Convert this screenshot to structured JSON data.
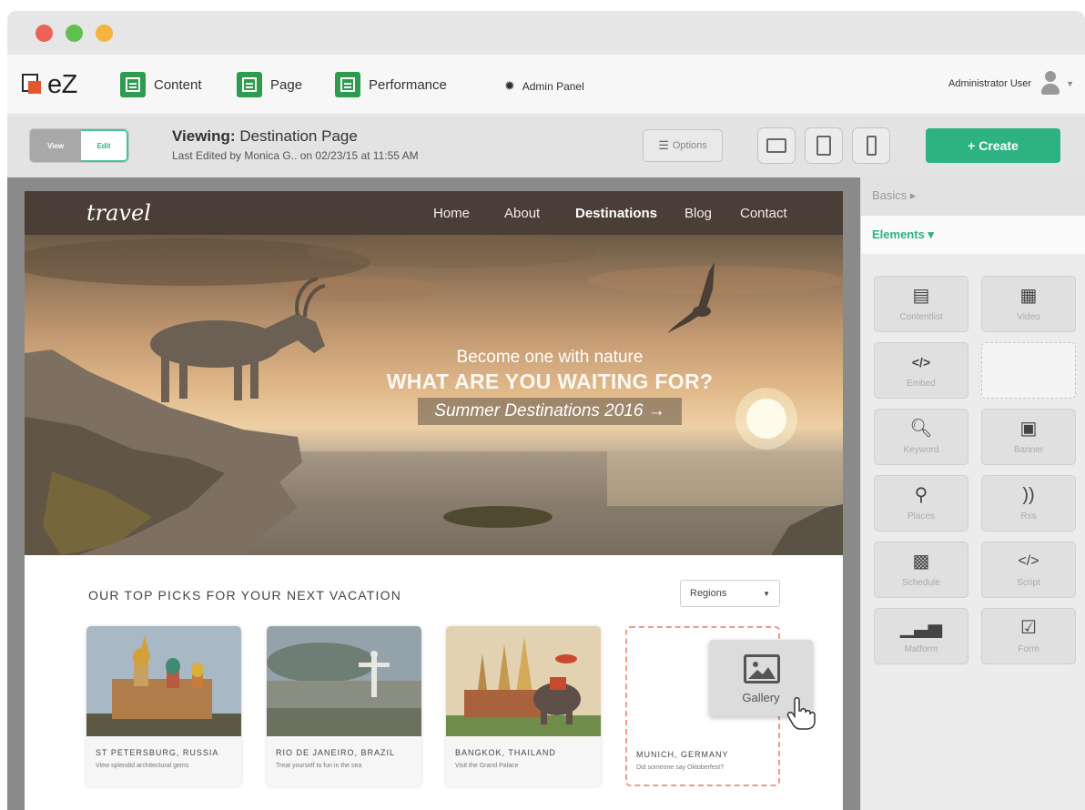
{
  "app": {
    "logo_text": "eZ"
  },
  "nav": [
    {
      "label": "Content",
      "icon": "content-icon"
    },
    {
      "label": "Page",
      "icon": "page-icon"
    },
    {
      "label": "Performance",
      "icon": "performance-icon"
    }
  ],
  "admin_panel": {
    "label": "Admin Panel",
    "icon": "gear-icon"
  },
  "user": {
    "name": "Administrator User",
    "icon": "user-avatar-icon"
  },
  "mode_toggle": {
    "view_label": "View",
    "edit_label": "Edit",
    "active": "Edit"
  },
  "viewing": {
    "prefix": "Viewing:",
    "page_name": "Destination Page",
    "last_edited": "Last Edited by Monica G.. on 02/23/15 at 11:55 AM"
  },
  "options_label": "Options",
  "devices": [
    "desktop-icon",
    "tablet-icon",
    "phone-icon"
  ],
  "create_label": "+ Create",
  "site": {
    "logo": "travel",
    "links": [
      "Home",
      "About",
      "Destinations",
      "Blog",
      "Contact"
    ],
    "active_link": "Destinations",
    "hero": {
      "line1": "Become one with nature",
      "line2": "WHAT ARE YOU WAITING FOR?",
      "line3": "Summer Destinations 2016 →"
    },
    "picks_title": "OUR TOP PICKS FOR YOUR NEXT VACATION",
    "regions_label": "Regions",
    "cards": [
      {
        "name": "ST PETERSBURG, RUSSIA",
        "desc": "View splendid architectural gems"
      },
      {
        "name": "RIO DE JANEIRO, BRAZIL",
        "desc": "Treat yourself to fun in the sea"
      },
      {
        "name": "BANGKOK, THAILAND",
        "desc": "Visit the Grand Palace"
      },
      {
        "name": "MUNICH, GERMANY",
        "desc": "Did someone say Oktoberfest?"
      }
    ],
    "dragging_label": "Gallery"
  },
  "panel": {
    "basics_label": "Basics ▸",
    "elements_label": "Elements ▾",
    "tiles": [
      {
        "label": "Contentlist",
        "icon": "contentlist-icon"
      },
      {
        "label": "Video",
        "icon": "video-icon"
      },
      {
        "label": "Embed",
        "icon": "embed-icon"
      },
      {
        "label": "",
        "icon": ""
      },
      {
        "label": "Keyword",
        "icon": "keyword-icon"
      },
      {
        "label": "Banner",
        "icon": "banner-icon"
      },
      {
        "label": "Places",
        "icon": "places-icon"
      },
      {
        "label": "Rss",
        "icon": "rss-icon"
      },
      {
        "label": "Schedule",
        "icon": "schedule-icon"
      },
      {
        "label": "Script",
        "icon": "script-icon"
      },
      {
        "label": "Matform",
        "icon": "matform-icon"
      },
      {
        "label": "Form",
        "icon": "form-icon"
      }
    ]
  },
  "colors": {
    "accent": "#2db283",
    "nav_green": "#2f9b4f",
    "site_nav": "#4a3e36"
  }
}
